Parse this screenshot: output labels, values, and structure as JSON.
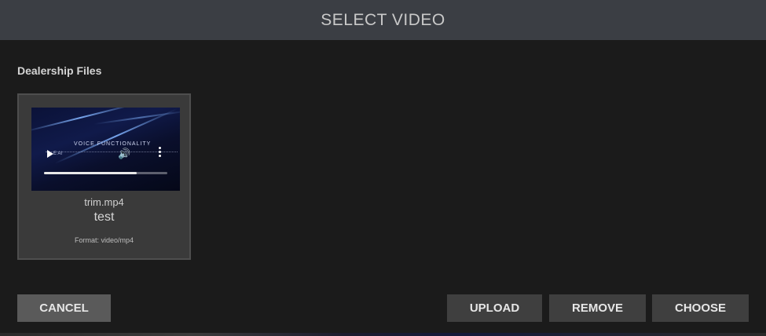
{
  "header": {
    "title": "SELECT VIDEO"
  },
  "section": {
    "label": "Dealership Files"
  },
  "files": [
    {
      "file_name": "trim.mp4",
      "title": "test",
      "format": "Format: video/mp4",
      "thumbnail": {
        "caption": "VOICE FUNCTIONALITY",
        "sub": "E AI",
        "progress": 0.75,
        "icons": [
          "play-icon",
          "volume-icon",
          "more-vertical-icon"
        ]
      }
    }
  ],
  "buttons": {
    "cancel": "CANCEL",
    "upload": "UPLOAD",
    "remove": "REMOVE",
    "choose": "CHOOSE"
  },
  "colors": {
    "header_bg": "#3b3e44",
    "dialog_bg": "#1b1b1b",
    "card_bg": "#3a3a3a",
    "button_bg": "#3f3f3f",
    "cancel_bg": "#5a5a5a"
  }
}
